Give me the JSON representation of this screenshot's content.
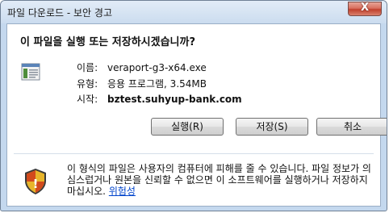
{
  "window": {
    "title": "파일 다운로드 - 보안 경고",
    "close_glyph": "X"
  },
  "dialog": {
    "heading": "이 파일을 실행 또는 저장하시겠습니까?",
    "file_icon": "executable-file-icon",
    "name_label": "이름:",
    "name_value": "veraport-g3-x64.exe",
    "type_label": "유형:",
    "type_value": "응용 프로그램, 3.54MB",
    "from_label": "시작:",
    "from_value": "bztest.suhyup-bank.com"
  },
  "buttons": {
    "run": "실행(R)",
    "save": "저장(S)",
    "cancel": "취소"
  },
  "warning": {
    "icon": "security-shield-icon",
    "text": "이 형식의 파일은 사용자의 컴퓨터에 피해를 줄 수 있습니다. 파일 정보가 의심스럽거나 원본을 신뢰할 수 없으면 이 소프트웨어를 실행하거나 저장하지 마십시오.",
    "link": "위험성"
  }
}
